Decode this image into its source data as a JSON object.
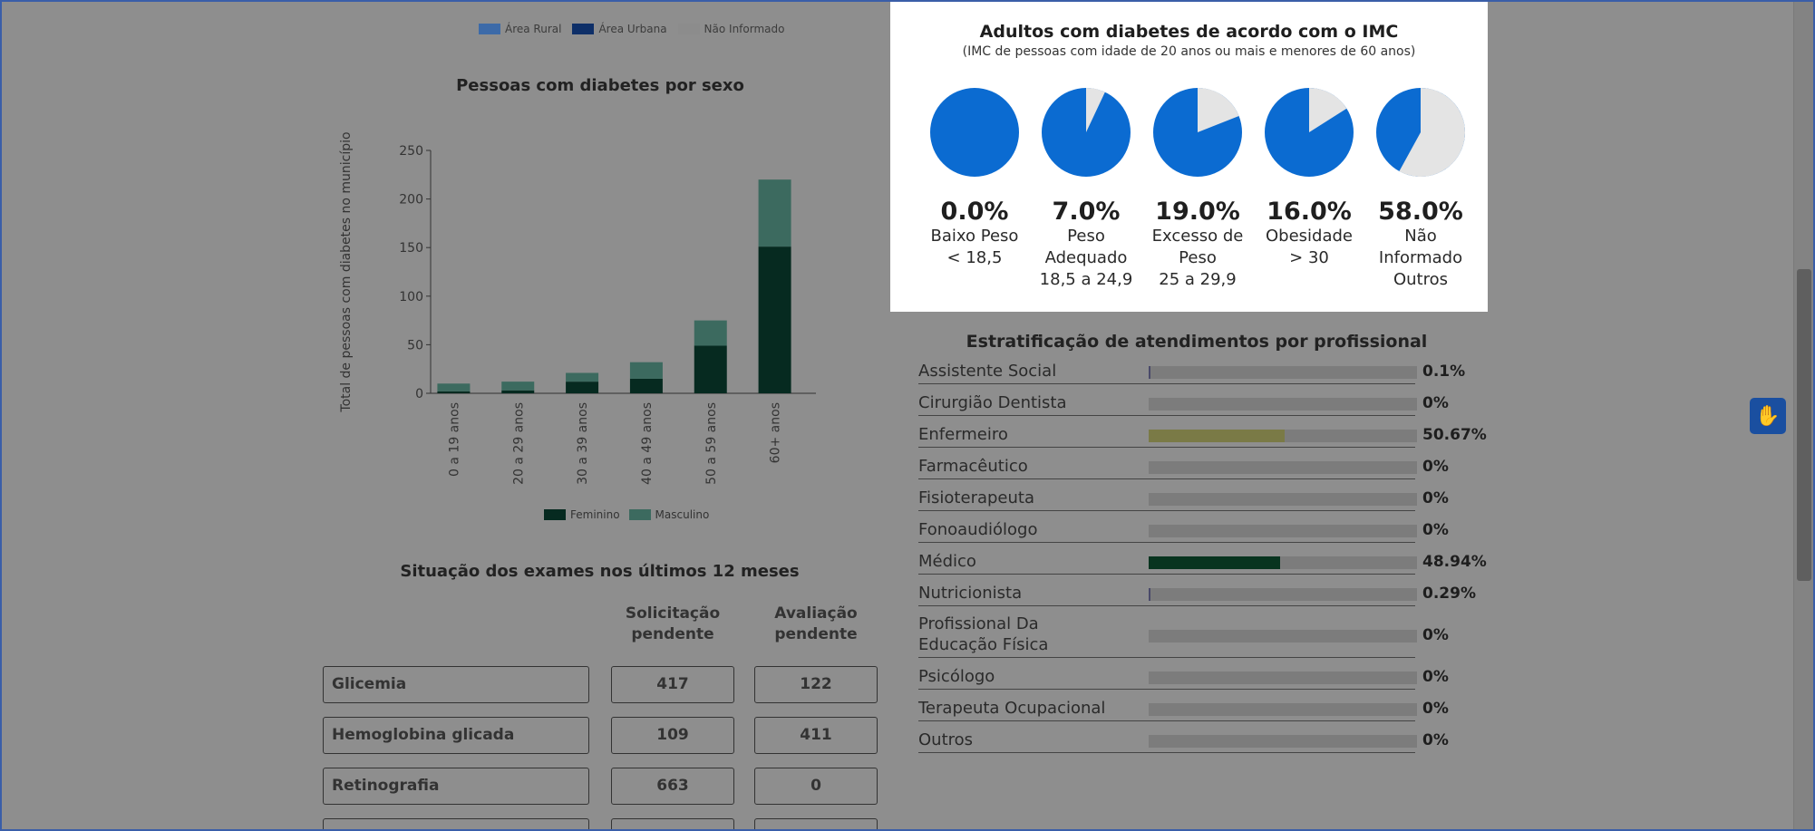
{
  "top_legend": [
    {
      "label": "Área Rural",
      "color": "#3c6aa8"
    },
    {
      "label": "Área Urbana",
      "color": "#0e2f68"
    },
    {
      "label": "Não Informado",
      "color": "#8c8c8c"
    }
  ],
  "chart_data": [
    {
      "type": "bar",
      "stacked": true,
      "title": "Pessoas com diabetes por sexo",
      "ylabel": "Total de pessoas com diabetes no município",
      "xlabel": "",
      "categories": [
        "0 a 19 anos",
        "20 a 29 anos",
        "30 a 39 anos",
        "40 a 49 anos",
        "50 a 59 anos",
        "60+ anos"
      ],
      "series": [
        {
          "name": "Feminino",
          "color": "#062a20",
          "values": [
            2,
            3,
            12,
            15,
            49,
            151
          ]
        },
        {
          "name": "Masculino",
          "color": "#3c6a5f",
          "values": [
            8,
            9,
            9,
            17,
            26,
            69
          ]
        }
      ],
      "ylim": [
        0,
        250
      ],
      "yticks": [
        0,
        50,
        100,
        150,
        200,
        250
      ],
      "legend": "bottom"
    },
    {
      "type": "pie",
      "title": "Adultos com diabetes de acordo com o IMC",
      "subtitle": "(IMC de pessoas com idade de 20 anos ou mais e menores de 60 anos)",
      "colors": {
        "value": "#0b6bd1",
        "rest": "#e4e4e4"
      },
      "items": [
        {
          "percent_label": "0.0%",
          "value": 0.0,
          "lines": [
            "Baixo Peso",
            "< 18,5"
          ]
        },
        {
          "percent_label": "7.0%",
          "value": 7.0,
          "lines": [
            "Peso",
            "Adequado",
            "18,5 a 24,9"
          ]
        },
        {
          "percent_label": "19.0%",
          "value": 19.0,
          "lines": [
            "Excesso de",
            "Peso",
            "25 a 29,9"
          ]
        },
        {
          "percent_label": "16.0%",
          "value": 16.0,
          "lines": [
            "Obesidade",
            "> 30"
          ]
        },
        {
          "percent_label": "58.0%",
          "value": 58.0,
          "lines": [
            "Não",
            "Informado",
            "Outros"
          ]
        }
      ]
    },
    {
      "type": "bar",
      "orientation": "horizontal",
      "title": "Estratificação de atendimentos por profissional",
      "rows": [
        {
          "label": "Assistente Social",
          "value": 0.1,
          "value_label": "0.1%",
          "color": "#4a4a6a"
        },
        {
          "label": "Cirurgião Dentista",
          "value": 0,
          "value_label": "0%",
          "color": "#7c7c7c"
        },
        {
          "label": "Enfermeiro",
          "value": 50.67,
          "value_label": "50.67%",
          "color": "#7a7a46"
        },
        {
          "label": "Farmacêutico",
          "value": 0,
          "value_label": "0%",
          "color": "#7c7c7c"
        },
        {
          "label": "Fisioterapeuta",
          "value": 0,
          "value_label": "0%",
          "color": "#7c7c7c"
        },
        {
          "label": "Fonoaudiólogo",
          "value": 0,
          "value_label": "0%",
          "color": "#7c7c7c"
        },
        {
          "label": "Médico",
          "value": 48.94,
          "value_label": "48.94%",
          "color": "#08341f"
        },
        {
          "label": "Nutricionista",
          "value": 0.29,
          "value_label": "0.29%",
          "color": "#4a4a6a"
        },
        {
          "label": "Profissional Da Educação Física",
          "value": 0,
          "value_label": "0%",
          "color": "#7c7c7c"
        },
        {
          "label": "Psicólogo",
          "value": 0,
          "value_label": "0%",
          "color": "#7c7c7c"
        },
        {
          "label": "Terapeuta Ocupacional",
          "value": 0,
          "value_label": "0%",
          "color": "#7c7c7c"
        },
        {
          "label": "Outros",
          "value": 0,
          "value_label": "0%",
          "color": "#7c7c7c"
        }
      ]
    },
    {
      "type": "table",
      "title": "Situação dos exames nos últimos 12 meses",
      "columns": [
        "Solicitação pendente",
        "Avaliação pendente"
      ],
      "column_lines": [
        [
          "Solicitação",
          "pendente"
        ],
        [
          "Avaliação",
          "pendente"
        ]
      ],
      "rows": [
        {
          "name": "Glicemia",
          "values": [
            "417",
            "122"
          ]
        },
        {
          "name": "Hemoglobina glicada",
          "values": [
            "109",
            "411"
          ]
        },
        {
          "name": "Retinografia",
          "values": [
            "663",
            "0"
          ]
        }
      ]
    }
  ],
  "accessibility_button": {
    "icon": "sign-language-hand-icon"
  }
}
